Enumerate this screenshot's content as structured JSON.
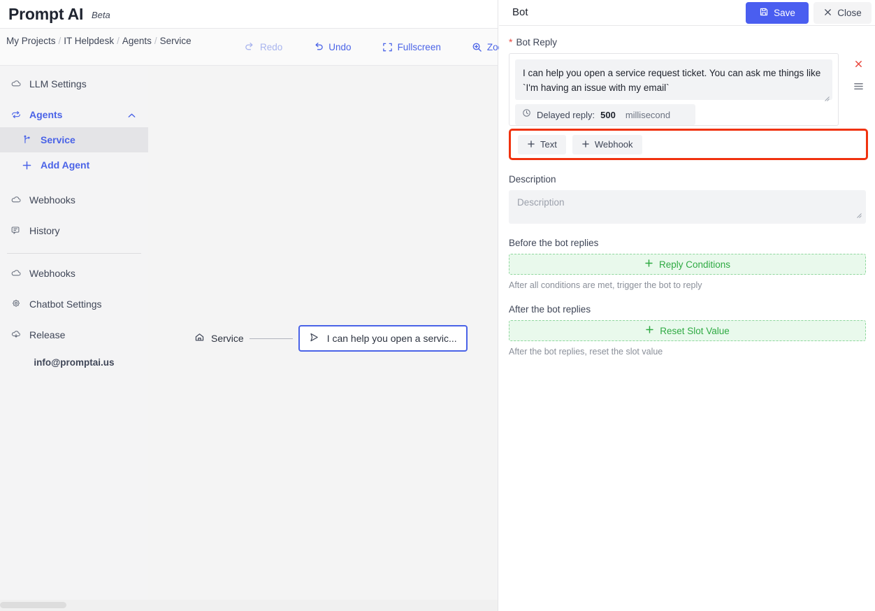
{
  "brand": {
    "name": "Prompt AI",
    "tag": "Beta"
  },
  "breadcrumb": {
    "items": [
      "My Projects",
      "IT Helpdesk",
      "Agents",
      "Service"
    ],
    "separator": "/"
  },
  "toolbar": {
    "redo": {
      "label": "Redo",
      "icon": "redo-icon",
      "disabled": true
    },
    "undo": {
      "label": "Undo",
      "icon": "undo-icon",
      "disabled": false
    },
    "fullscreen": {
      "label": "Fullscreen",
      "icon": "fullscreen-icon"
    },
    "zoom": {
      "label": "Zoom",
      "icon": "zoom-in-icon"
    }
  },
  "sidebar": {
    "items": [
      {
        "label": "LLM Settings",
        "icon": "cloud-icon",
        "state": "normal"
      },
      {
        "label": "Agents",
        "icon": "agents-icon",
        "state": "expanded-group",
        "chevron": "chevron-up-icon"
      },
      {
        "label": "Service",
        "icon": "branch-icon",
        "state": "active-sub"
      },
      {
        "label": "Add Agent",
        "icon": "plus-icon",
        "state": "action-sub"
      },
      {
        "label": "Webhooks",
        "icon": "cloud-icon",
        "state": "normal"
      },
      {
        "label": "History",
        "icon": "history-icon",
        "state": "normal"
      }
    ],
    "items_lower": [
      {
        "label": "Webhooks",
        "icon": "cloud-icon"
      },
      {
        "label": "Chatbot Settings",
        "icon": "gear-icon"
      },
      {
        "label": "Release",
        "icon": "release-icon"
      }
    ],
    "email": "info@promptai.us"
  },
  "canvas": {
    "start_node": {
      "label": "Service",
      "icon": "home-icon"
    },
    "bot_node": {
      "label": "I can help you open a servic...",
      "icon": "send-icon"
    }
  },
  "panel": {
    "title": "Bot",
    "save_label": "Save",
    "save_icon": "save-disk-icon",
    "close_label": "Close",
    "close_icon": "close-x-icon",
    "bot_reply": {
      "label": "Bot Reply",
      "required_marker": "*",
      "text": "I can help you open a service request ticket. You can ask me things like `I'm having an issue with my email`",
      "delay": {
        "icon": "clock-icon",
        "label": "Delayed reply:",
        "value": "500",
        "unit": "millisecond"
      },
      "remove_icon": "close-x-icon",
      "drag_icon": "drag-handle-icon"
    },
    "add_buttons": [
      {
        "label": "Text",
        "icon": "plus-icon"
      },
      {
        "label": "Webhook",
        "icon": "plus-icon"
      }
    ],
    "description": {
      "label": "Description",
      "value": "",
      "placeholder": "Description"
    },
    "before_reply": {
      "label": "Before the bot replies",
      "button_label": "Reply Conditions",
      "button_icon": "plus-icon",
      "hint": "After all conditions are met, trigger the bot to reply"
    },
    "after_reply": {
      "label": "After the bot replies",
      "button_label": "Reset Slot Value",
      "button_icon": "plus-icon",
      "hint": "After the bot replies, reset the slot value"
    }
  },
  "colors": {
    "accent_blue": "#4a63e7",
    "save_blue": "#4a5ef0",
    "highlight_red": "#f0320f",
    "required_red": "#e8453c",
    "green": "#2faa43",
    "green_bg": "#e9f9ec"
  }
}
